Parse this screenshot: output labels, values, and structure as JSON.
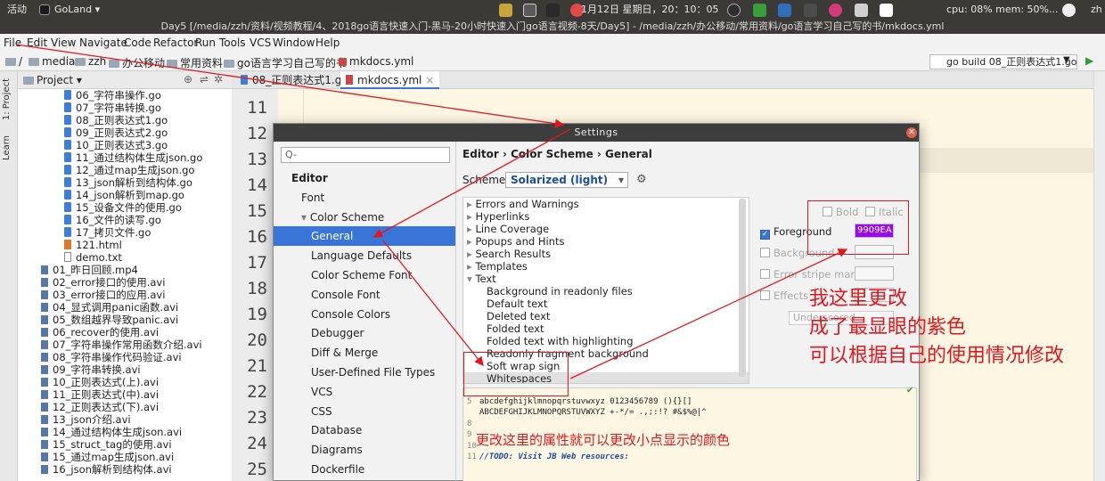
{
  "system_bar": {
    "activities": "活动",
    "app_name": "GoLand",
    "datetime": "1月12日 星期日，20：10：05",
    "stats": "cpu: 08% mem: 50%...",
    "user": "zh"
  },
  "window_title": "Day5 [/media/zzh/资料/视频教程/4、2018go语言快速入门-黑马-20小时快速入门go语言视频-8天/Day5] - /media/zzh/办公移动/常用资料/go语言学习自己写的书/mkdocs.yml",
  "menu": [
    "File",
    "Edit",
    "View",
    "Navigate",
    "Code",
    "Refactor",
    "Run",
    "Tools",
    "VCS",
    "Window",
    "Help"
  ],
  "breadcrumb": [
    "/",
    "media",
    "zzh",
    "办公移动",
    "常用资料",
    "go语言学习自己写的书",
    "mkdocs.yml"
  ],
  "run_config": "go build 08_正则表达式1.go",
  "left_strip": {
    "project": "1: Project",
    "learn": "Learn"
  },
  "project_panel": {
    "title": "Project"
  },
  "project_tree": [
    {
      "name": "06_字符串操作.go",
      "type": "go",
      "indent": 1
    },
    {
      "name": "07_字符串转换.go",
      "type": "go",
      "indent": 1
    },
    {
      "name": "08_正则表达式1.go",
      "type": "go",
      "indent": 1
    },
    {
      "name": "09_正则表达式2.go",
      "type": "go",
      "indent": 1
    },
    {
      "name": "10_正则表达式3.go",
      "type": "go",
      "indent": 1
    },
    {
      "name": "11_通过结构体生成json.go",
      "type": "go",
      "indent": 1
    },
    {
      "name": "12_通过map生成json.go",
      "type": "go",
      "indent": 1
    },
    {
      "name": "13_json解析到结构体.go",
      "type": "go",
      "indent": 1
    },
    {
      "name": "14_json解析到map.go",
      "type": "go",
      "indent": 1
    },
    {
      "name": "15_设备文件的使用.go",
      "type": "go",
      "indent": 1
    },
    {
      "name": "16_文件的读写.go",
      "type": "go",
      "indent": 1
    },
    {
      "name": "17_拷贝文件.go",
      "type": "go",
      "indent": 1
    },
    {
      "name": "121.html",
      "type": "html",
      "indent": 1
    },
    {
      "name": "demo.txt",
      "type": "txt",
      "indent": 1
    },
    {
      "name": "01_昨日回顾.mp4",
      "type": "video",
      "indent": 0
    },
    {
      "name": "02_error接口的使用.avi",
      "type": "video",
      "indent": 0
    },
    {
      "name": "03_error接口的应用.avi",
      "type": "video",
      "indent": 0
    },
    {
      "name": "04_显式调用panic函数.avi",
      "type": "video",
      "indent": 0
    },
    {
      "name": "05_数组越界导致panic.avi",
      "type": "video",
      "indent": 0
    },
    {
      "name": "06_recover的使用.avi",
      "type": "video",
      "indent": 0
    },
    {
      "name": "07_字符串操作常用函数介绍.avi",
      "type": "video",
      "indent": 0
    },
    {
      "name": "08_字符串操作代码验证.avi",
      "type": "video",
      "indent": 0
    },
    {
      "name": "09_字符串转换.avi",
      "type": "video",
      "indent": 0
    },
    {
      "name": "10_正则表达式(上).avi",
      "type": "video",
      "indent": 0
    },
    {
      "name": "11_正则表达式(中).avi",
      "type": "video",
      "indent": 0
    },
    {
      "name": "12_正则表达式(下).avi",
      "type": "video",
      "indent": 0
    },
    {
      "name": "13_json介绍.avi",
      "type": "video",
      "indent": 0
    },
    {
      "name": "14_通过结构体生成json.avi",
      "type": "video",
      "indent": 0
    },
    {
      "name": "15_struct_tag的使用.avi",
      "type": "video",
      "indent": 0
    },
    {
      "name": "15_通过map生成json.avi",
      "type": "video",
      "indent": 0
    },
    {
      "name": "16_json解析到结构体.avi",
      "type": "video",
      "indent": 0
    }
  ],
  "tabs": [
    {
      "label": "08_正则表达式1.go",
      "active": false
    },
    {
      "label": "mkdocs.yml",
      "active": true
    }
  ],
  "line_numbers": [
    "11",
    "12",
    "13",
    "14",
    "15",
    "16",
    "17",
    "18",
    "19",
    "20",
    "21",
    "22",
    "23",
    "24",
    "25"
  ],
  "settings": {
    "title": "Settings",
    "search_placeholder": "Q-",
    "breadcrumb": [
      "Editor",
      "Color Scheme",
      "General"
    ],
    "scheme_label": "Scheme:",
    "scheme_value": "Solarized (light)",
    "tree": [
      {
        "label": "Editor",
        "level": 0,
        "bold": true
      },
      {
        "label": "Font",
        "level": 1
      },
      {
        "label": "Color Scheme",
        "level": 1,
        "expanded": true
      },
      {
        "label": "General",
        "level": 2,
        "selected": true
      },
      {
        "label": "Language Defaults",
        "level": 2
      },
      {
        "label": "Color Scheme Font",
        "level": 2
      },
      {
        "label": "Console Font",
        "level": 2
      },
      {
        "label": "Console Colors",
        "level": 2
      },
      {
        "label": "Debugger",
        "level": 2
      },
      {
        "label": "Diff & Merge",
        "level": 2
      },
      {
        "label": "User-Defined File Types",
        "level": 2
      },
      {
        "label": "VCS",
        "level": 2
      },
      {
        "label": "CSS",
        "level": 2
      },
      {
        "label": "Database",
        "level": 2
      },
      {
        "label": "Diagrams",
        "level": 2
      },
      {
        "label": "Dockerfile",
        "level": 2
      }
    ],
    "attributes": [
      {
        "label": "Errors and Warnings",
        "level": 0,
        "arrow": "right"
      },
      {
        "label": "Hyperlinks",
        "level": 0,
        "arrow": "right"
      },
      {
        "label": "Line Coverage",
        "level": 0,
        "arrow": "right"
      },
      {
        "label": "Popups and Hints",
        "level": 0,
        "arrow": "right"
      },
      {
        "label": "Search Results",
        "level": 0,
        "arrow": "right"
      },
      {
        "label": "Templates",
        "level": 0,
        "arrow": "right"
      },
      {
        "label": "Text",
        "level": 0,
        "arrow": "down"
      },
      {
        "label": "Background in readonly files",
        "level": 1
      },
      {
        "label": "Default text",
        "level": 1
      },
      {
        "label": "Deleted text",
        "level": 1
      },
      {
        "label": "Folded text",
        "level": 1
      },
      {
        "label": "Folded text with highlighting",
        "level": 1
      },
      {
        "label": "Readonly fragment background",
        "level": 1
      },
      {
        "label": "Soft wrap sign",
        "level": 1
      },
      {
        "label": "Whitespaces",
        "level": 1,
        "selected": true
      }
    ],
    "options": {
      "bold": "Bold",
      "italic": "Italic",
      "foreground": "Foreground",
      "foreground_value": "9909EA",
      "foreground_color": "#9909EA",
      "background": "Background",
      "error_stripe": "Error stripe mark",
      "effects": "Effects",
      "effect_type": "Underscored"
    },
    "preview_lines": [
      {
        "num": "5",
        "text": "abcdefghijklmnopqrstuvwxyz 0123456789 (){}[]",
        "style": "normal"
      },
      {
        "num": "",
        "text": "ABCDEFGHIJKLMNOPQRSTUVWXYZ +-*/= .,;:!? #&$%@|^",
        "style": "normal"
      },
      {
        "num": "8",
        "text": "",
        "style": "normal"
      },
      {
        "num": "9",
        "text": "",
        "style": "normal"
      },
      {
        "num": "10",
        "text": "",
        "style": "normal"
      },
      {
        "num": "11",
        "text": "//TODO: Visit JB Web resources:",
        "style": "todo"
      }
    ]
  },
  "annotations": {
    "note_main": [
      "我这里更改",
      "成了最显眼的紫色",
      "可以根据自己的使用情况修改"
    ],
    "note_preview": "更改这里的属性就可以更改小点显示的颜色",
    "color": "#e0181e"
  },
  "colors": {
    "selection": "#3875d7",
    "editor_bg": "#fdf6e3",
    "go_file": "#3d7fd6"
  }
}
